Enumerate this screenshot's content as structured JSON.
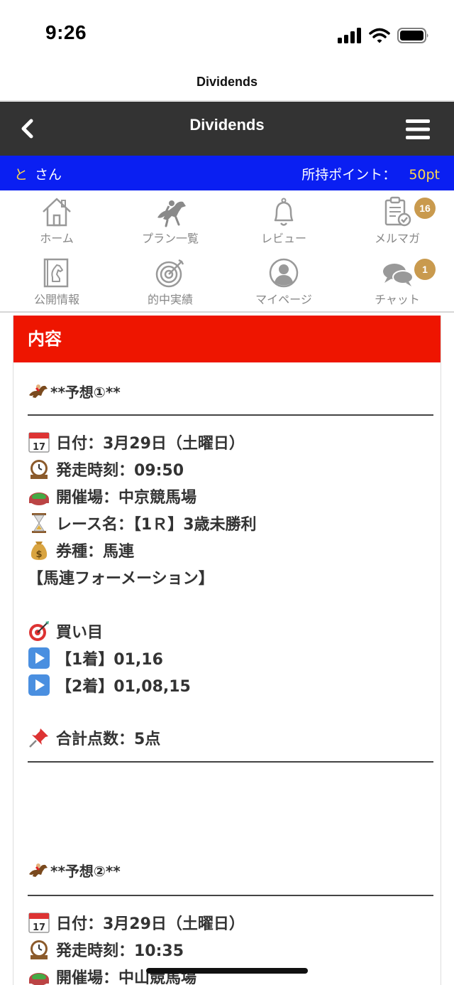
{
  "status_bar": {
    "time": "9:26"
  },
  "page_title": "Dividends",
  "app_bar": {
    "title": "Dividends"
  },
  "user_bar": {
    "name_first": "と",
    "name_rest": "さん",
    "points_label": "所持ポイント：",
    "points_value": "50pt"
  },
  "nav": {
    "items": [
      {
        "label": "ホーム",
        "icon": "home-icon"
      },
      {
        "label": "プラン一覧",
        "icon": "horse-rider-icon"
      },
      {
        "label": "レビュー",
        "icon": "bell-icon"
      },
      {
        "label": "メルマガ",
        "icon": "clipboard-check-icon",
        "badge": "16"
      },
      {
        "label": "公開情報",
        "icon": "chess-knight-book-icon"
      },
      {
        "label": "的中実績",
        "icon": "target-icon"
      },
      {
        "label": "マイページ",
        "icon": "user-icon"
      },
      {
        "label": "チャット",
        "icon": "chat-bubbles-icon",
        "badge": "1"
      }
    ]
  },
  "content": {
    "header": "内容",
    "prediction1": {
      "title": "**予想①**",
      "date": "日付：3月29日（土曜日）",
      "start_time": "発走時刻：09:50",
      "venue": "開催場：中京競馬場",
      "race_name": "レース名：【1Ｒ】3歳未勝利",
      "ticket_type": "券種：馬連",
      "formation": "【馬連フォーメーション】",
      "buy_label": "買い目",
      "pick1": "【1着】01,16",
      "pick2": "【2着】01,08,15",
      "total": "合計点数：5点"
    },
    "prediction2": {
      "title": "**予想②**",
      "date": "日付：3月29日（土曜日）",
      "start_time": "発走時刻：10:35",
      "venue": "開催場：中山競馬場"
    }
  },
  "colors": {
    "app_bar": "#333333",
    "user_bar": "#0a1ff2",
    "points": "#ffd84a",
    "card_header": "#ee1500",
    "badge": "#c99a4e"
  }
}
